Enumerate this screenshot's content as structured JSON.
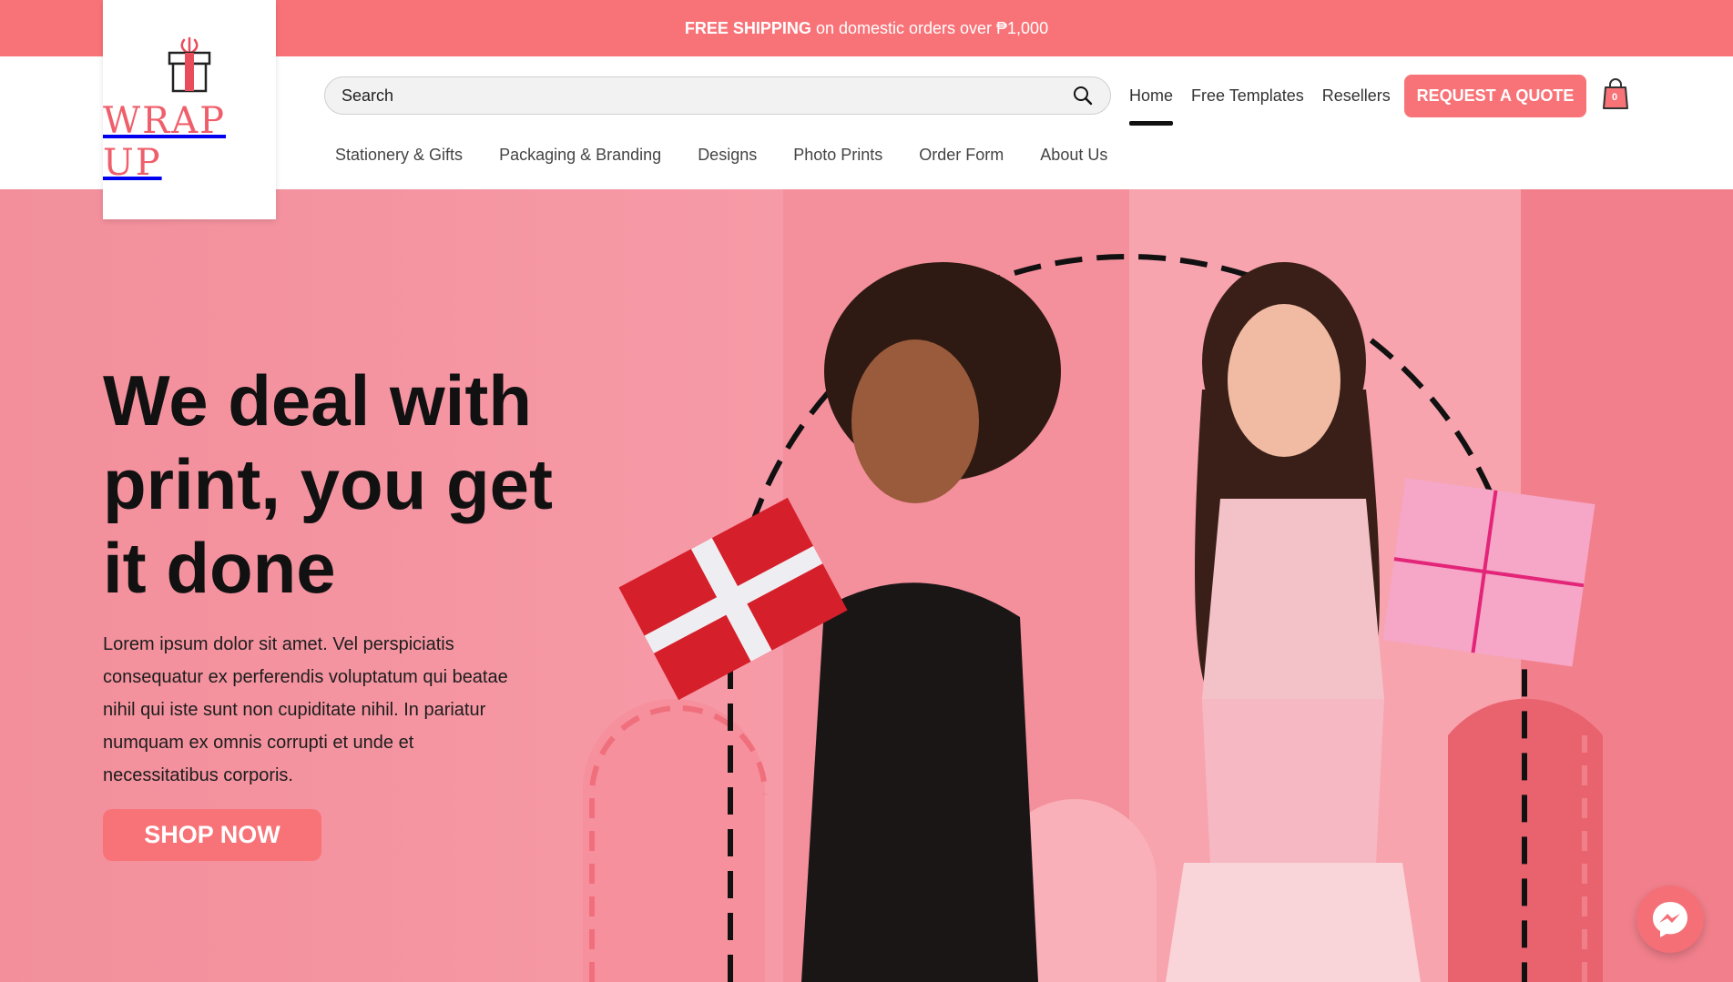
{
  "promo": {
    "bold": "FREE SHIPPING",
    "rest": " on domestic orders over ₱1,000"
  },
  "brand": {
    "name": "WRAP UP",
    "accent": "#f87378"
  },
  "search": {
    "placeholder": "Search",
    "value": ""
  },
  "topnav": [
    {
      "label": "Home",
      "active": true
    },
    {
      "label": "Free Templates",
      "active": false
    },
    {
      "label": "Resellers",
      "active": false
    }
  ],
  "quote_button": "REQUEST A QUOTE",
  "cart": {
    "count": "0",
    "icon": "shopping-bag-icon"
  },
  "mainnav": [
    {
      "label": "Stationery & Gifts"
    },
    {
      "label": "Packaging & Branding"
    },
    {
      "label": "Designs"
    },
    {
      "label": "Photo Prints"
    },
    {
      "label": "Order Form"
    },
    {
      "label": "About Us"
    }
  ],
  "hero": {
    "headline": "We deal with print, you get it done",
    "description": "Lorem ipsum dolor sit amet. Vel perspiciatis consequatur ex perferendis voluptatum qui beatae nihil qui iste sunt non cupiditate nihil. In pariatur numquam ex omnis corrupti et unde et necessitatibus corporis.",
    "cta": "SHOP NOW"
  },
  "chat": {
    "icon": "messenger-icon"
  }
}
